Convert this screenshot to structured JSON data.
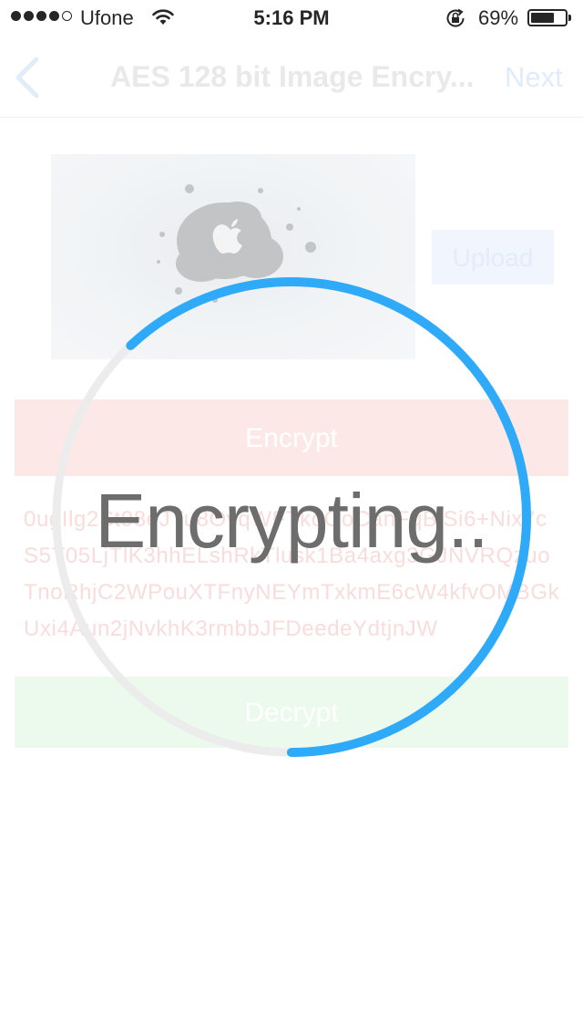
{
  "status_bar": {
    "carrier": "Ufone",
    "time": "5:16 PM",
    "battery_percent": "69%",
    "battery_level": 0.69,
    "signal_dots_filled": 4,
    "signal_dots_total": 5,
    "icons": [
      "wifi-icon",
      "rotation-lock-icon",
      "battery-icon"
    ]
  },
  "nav": {
    "back_icon": "chevron-left-icon",
    "title": "AES 128 bit Image Encry...",
    "next_label": "Next"
  },
  "upload": {
    "label": "Upload"
  },
  "encrypt": {
    "label": "Encrypt"
  },
  "cipher_text": "0ugIlg2St98eJTu8OvqWFTkoOoCanFqBlSi6+Nix7cS5T05LjTlK3hhELshRkTlusk1Ba4axg3GJNVRQzuoTnoRhjC2WPouXTFnyNEYmTxkmE6cW4kfvOMBGkUxi4Aun2jNvkhK3rmbbJFDeedeYdtjnJW",
  "decrypt": {
    "label": "Decrypt"
  },
  "progress": {
    "label": "Encrypting..",
    "fraction": 0.62,
    "colors": {
      "arc": "#2eaaf9",
      "track": "#ececec"
    }
  }
}
